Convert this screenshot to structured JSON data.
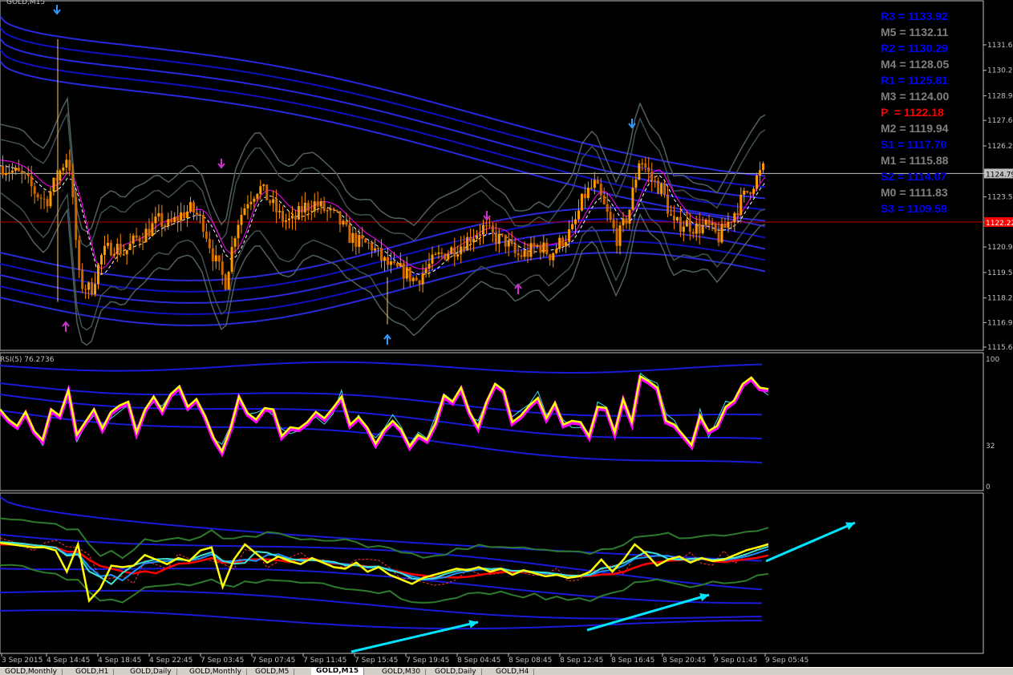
{
  "window": {
    "title": "GOLD,M15"
  },
  "colors": {
    "support": "#0000ff",
    "mid": "#808080",
    "pivot": "#ff0000",
    "price_up": "#ff9900",
    "price_down": "#ffcc66",
    "rsi": "#ffff00",
    "rsi_shadow": "#ff00ff",
    "arrows": "#00e5ff",
    "ma_red": "#ff0000",
    "band_green": "#1f5f1f"
  },
  "levels": [
    {
      "label": "R3",
      "value": "1133.92",
      "kind": "support"
    },
    {
      "label": "M5",
      "value": "1132.11",
      "kind": "mid"
    },
    {
      "label": "R2",
      "value": "1130.29",
      "kind": "support"
    },
    {
      "label": "M4",
      "value": "1128.05",
      "kind": "mid"
    },
    {
      "label": "R1",
      "value": "1125.81",
      "kind": "support"
    },
    {
      "label": "M3",
      "value": "1124.00",
      "kind": "mid"
    },
    {
      "label": "P ",
      "value": "1122.18",
      "kind": "pivot"
    },
    {
      "label": "M2",
      "value": "1119.94",
      "kind": "mid"
    },
    {
      "label": "S1",
      "value": "1117.70",
      "kind": "support"
    },
    {
      "label": "M1",
      "value": "1115.88",
      "kind": "mid"
    },
    {
      "label": "S2",
      "value": "1114.07",
      "kind": "support"
    },
    {
      "label": "M0",
      "value": "1111.83",
      "kind": "mid"
    },
    {
      "label": "S3",
      "value": "1109.59",
      "kind": "support"
    }
  ],
  "chart_data": [
    {
      "type": "candlestick",
      "title": "GOLD,M15",
      "ylim": [
        1115.6,
        1132.7
      ],
      "y_ticks": [
        "1131.60",
        "1130.25",
        "1128.90",
        "1127.60",
        "1126.25",
        "1124.79",
        "1123.55",
        "1122.22",
        "1120.90",
        "1119.55",
        "1118.20",
        "1116.90",
        "1115.60"
      ],
      "current_price": "1124.79",
      "pivot_line": "1122.22",
      "x_ticks": [
        "3 Sep 2015",
        "4 Sep 14:45",
        "4 Sep 18:45",
        "4 Sep 22:45",
        "7 Sep 03:45",
        "7 Sep 07:45",
        "7 Sep 11:45",
        "7 Sep 15:45",
        "7 Sep 19:45",
        "8 Sep 04:45",
        "8 Sep 08:45",
        "8 Sep 12:45",
        "8 Sep 16:45",
        "8 Sep 20:45",
        "9 Sep 01:45",
        "9 Sep 05:45"
      ],
      "close_path": [
        1125.2,
        1124.9,
        1124.6,
        1123.8,
        1123.3,
        1124.6,
        1125.9,
        1119.0,
        1118.6,
        1120.5,
        1121.0,
        1120.6,
        1121.3,
        1121.7,
        1122.3,
        1122.0,
        1122.6,
        1122.9,
        1122.2,
        1120.3,
        1119.0,
        1122.1,
        1123.4,
        1124.1,
        1123.3,
        1122.4,
        1122.2,
        1123.0,
        1123.2,
        1122.8,
        1122.4,
        1121.5,
        1121.1,
        1121.0,
        1120.2,
        1119.7,
        1119.6,
        1119.1,
        1119.8,
        1120.4,
        1120.7,
        1121.0,
        1121.5,
        1121.9,
        1121.4,
        1121.2,
        1120.4,
        1120.6,
        1121.0,
        1120.5,
        1121.2,
        1121.8,
        1123.6,
        1124.2,
        1122.7,
        1121.3,
        1122.7,
        1125.7,
        1124.5,
        1123.9,
        1122.0,
        1122.2,
        1121.9,
        1122.0,
        1121.4,
        1122.3,
        1123.3,
        1124.2,
        1125.0
      ],
      "signal_arrows": [
        {
          "kind": "sell",
          "at": "4 Sep 14:45"
        },
        {
          "kind": "buy",
          "at": "4 Sep 14:45"
        },
        {
          "kind": "sell",
          "at": "7 Sep 03:45"
        },
        {
          "kind": "buy",
          "at": "7 Sep 15:45"
        },
        {
          "kind": "sell",
          "at": "8 Sep 04:45"
        },
        {
          "kind": "buy",
          "at": "8 Sep 08:45"
        },
        {
          "kind": "sell",
          "at": "8 Sep 16:45"
        }
      ]
    },
    {
      "type": "line",
      "title": "RSI(5) 76.2736",
      "ylim": [
        0,
        100
      ],
      "y_ticks": [
        "100",
        "32",
        "0"
      ],
      "values": [
        60,
        52,
        47,
        58,
        43,
        36,
        60,
        55,
        75,
        40,
        50,
        60,
        45,
        58,
        63,
        66,
        42,
        60,
        70,
        59,
        72,
        78,
        62,
        68,
        55,
        38,
        27,
        45,
        70,
        57,
        52,
        61,
        60,
        39,
        46,
        45,
        50,
        58,
        53,
        61,
        70,
        48,
        54,
        46,
        33,
        44,
        51,
        44,
        31,
        40,
        36,
        49,
        71,
        66,
        77,
        58,
        46,
        66,
        80,
        75,
        50,
        55,
        63,
        69,
        53,
        65,
        48,
        51,
        50,
        39,
        62,
        61,
        42,
        68,
        50,
        86,
        82,
        77,
        51,
        48,
        40,
        32,
        55,
        43,
        47,
        62,
        67,
        80,
        85,
        77,
        76
      ]
    },
    {
      "type": "line",
      "title": "",
      "values": [
        71,
        70,
        69,
        68,
        68,
        66,
        52,
        70,
        33,
        41,
        56,
        55,
        56,
        63,
        60,
        57,
        61,
        59,
        66,
        68,
        42,
        60,
        70,
        64,
        58,
        62,
        59,
        57,
        61,
        58,
        55,
        54,
        58,
        52,
        55,
        50,
        47,
        44,
        48,
        50,
        52,
        54,
        53,
        55,
        52,
        54,
        50,
        53,
        51,
        49,
        50,
        48,
        49,
        52,
        60,
        52,
        60,
        70,
        64,
        56,
        60,
        62,
        58,
        61,
        59,
        60,
        63,
        66,
        68,
        70
      ]
    }
  ],
  "tabs": [
    "GOLD,Monthly",
    "GOLD,H1",
    "GOLD,Daily",
    "GOLD,Monthly",
    "GOLD,M5",
    "GOLD,M15",
    "GOLD,M30",
    "GOLD,Daily",
    "GOLD,H4"
  ],
  "active_tab": "GOLD,M15"
}
